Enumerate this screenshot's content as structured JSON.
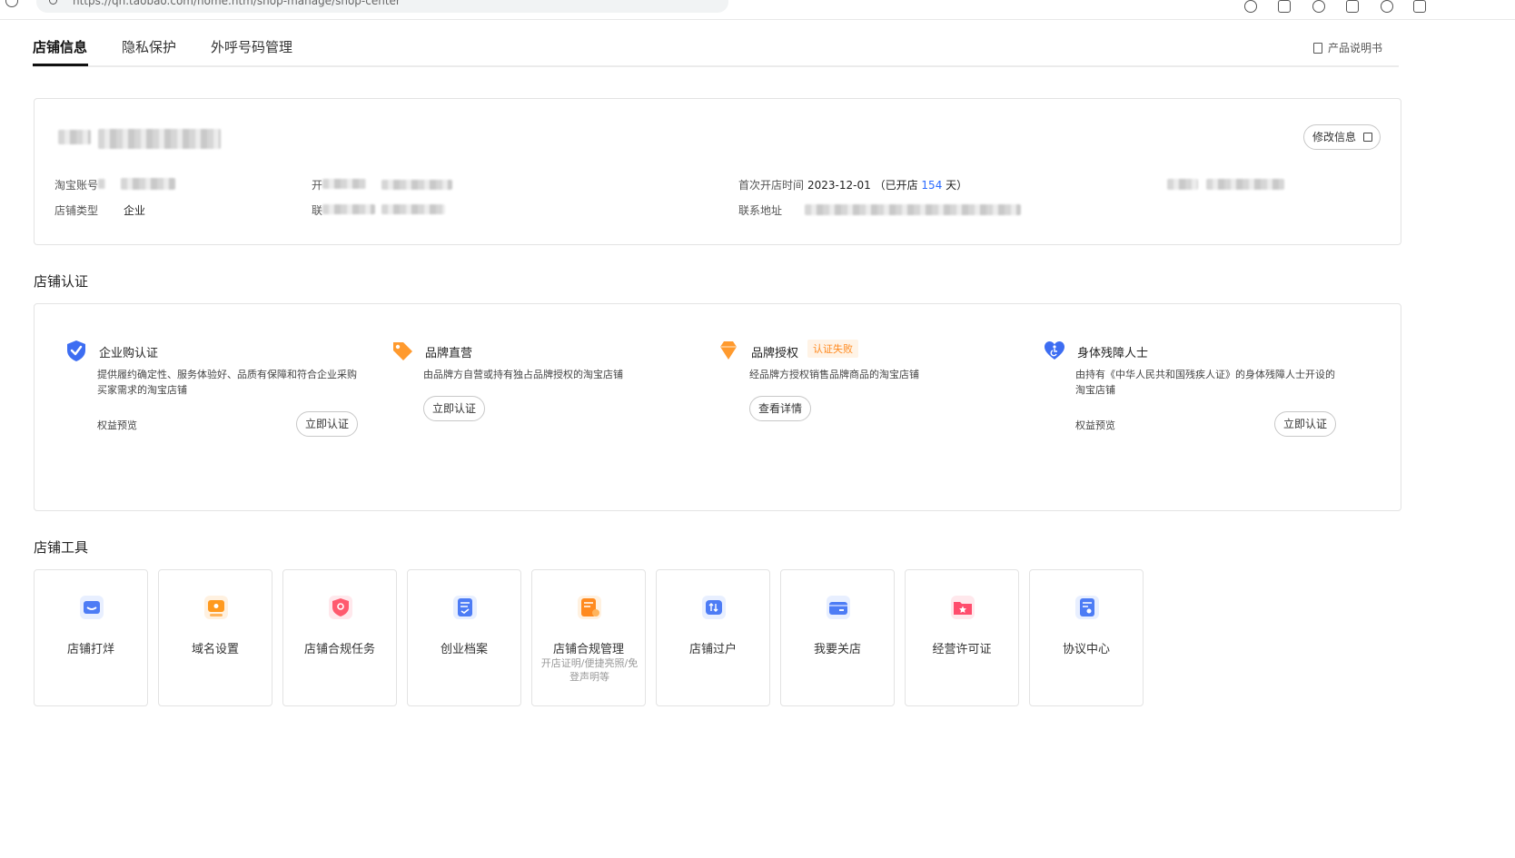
{
  "browser": {
    "url": "https://qn.taobao.com/home.htm/shop-manage/shop-center"
  },
  "tabs": [
    {
      "label": "店铺信息",
      "active": true
    },
    {
      "label": "隐私保护",
      "active": false
    },
    {
      "label": "外呼号码管理",
      "active": false
    }
  ],
  "manual_label": "产品说明书",
  "shop_info": {
    "edit_label": "修改信息",
    "taobao_account_label": "淘宝账号",
    "shop_type_label": "店铺类型",
    "shop_type_value": "企业",
    "open_time_label": "首次开店时间",
    "open_date": "2023-12-01",
    "open_days_prefix": "（已开店",
    "open_days": "154",
    "open_days_suffix": "天）",
    "address_label": "联系地址",
    "partial_label_1": "开",
    "partial_label_2": "联"
  },
  "certification": {
    "section_title": "店铺认证",
    "items": [
      {
        "title": "企业购认证",
        "desc": "提供履约确定性、服务体验好、品质有保障和符合企业采购买家需求的淘宝店铺",
        "benefit": "权益预览",
        "button": "立即认证"
      },
      {
        "title": "品牌直营",
        "desc": "由品牌方自营或持有独占品牌授权的淘宝店铺",
        "button": "立即认证"
      },
      {
        "title": "品牌授权",
        "badge": "认证失败",
        "desc": "经品牌方授权销售品牌商品的淘宝店铺",
        "button": "查看详情"
      },
      {
        "title": "身体残障人士",
        "desc": "由持有《中华人民共和国残疾人证》的身体残障人士开设的淘宝店铺",
        "benefit": "权益预览",
        "button": "立即认证"
      }
    ]
  },
  "tools": {
    "section_title": "店铺工具",
    "items": [
      {
        "name": "店铺打烊",
        "icon": "shop-close-icon",
        "color": "#4d7cf5"
      },
      {
        "name": "域名设置",
        "icon": "domain-icon",
        "color": "#ff9a1f"
      },
      {
        "name": "店铺合规任务",
        "icon": "compliance-task-icon",
        "color": "#ff5a6e"
      },
      {
        "name": "创业档案",
        "icon": "archive-icon",
        "color": "#4d7cf5"
      },
      {
        "name": "店铺合规管理",
        "sub": "开店证明/便捷亮照/免登声明等",
        "icon": "compliance-manage-icon",
        "color": "#ff8a1f"
      },
      {
        "name": "店铺过户",
        "icon": "transfer-icon",
        "color": "#4d7cf5"
      },
      {
        "name": "我要关店",
        "icon": "close-shop-icon",
        "color": "#4d7cf5"
      },
      {
        "name": "经营许可证",
        "icon": "license-icon",
        "color": "#ff4d6d"
      },
      {
        "name": "协议中心",
        "icon": "agreement-icon",
        "color": "#4d7cf5"
      }
    ]
  }
}
